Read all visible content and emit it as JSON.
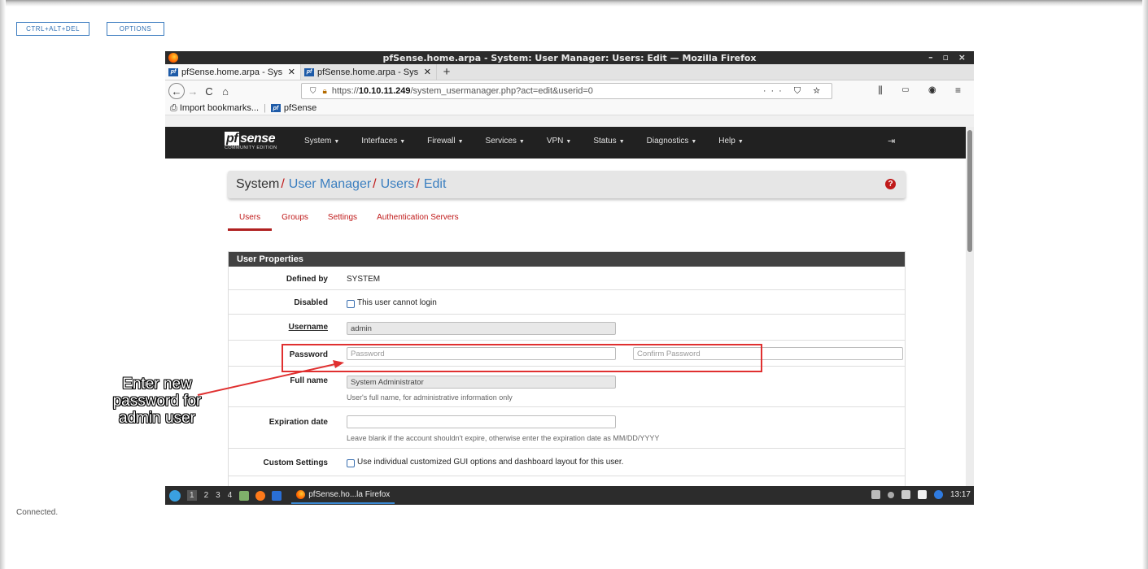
{
  "outer": {
    "ctrl_alt_del": "CTRL+ALT+DEL",
    "options": "OPTIONS",
    "status": "Connected."
  },
  "window": {
    "title": "pfSense.home.arpa - System: User Manager: Users: Edit — Mozilla Firefox",
    "controls": "– ▫ ×"
  },
  "tabs": [
    {
      "title": "pfSense.home.arpa - Sys",
      "fav": "pf"
    },
    {
      "title": "pfSense.home.arpa - Sys",
      "fav": "pf"
    }
  ],
  "url": {
    "prefix": "https://",
    "host": "10.10.11.249",
    "path": "/system_usermanager.php?act=edit&userid=0",
    "actions": "··· ⛉ ☆"
  },
  "nav_icons": {
    "back": "←",
    "forward": "→",
    "reload": "C",
    "home": "⌂",
    "right": "⫼ ▭ ◉ ≡"
  },
  "bookmarks": {
    "import": "Import bookmarks...",
    "pfsense": "pfSense"
  },
  "pfsense": {
    "logo": "sense",
    "logo_pf": "pf",
    "edition": "COMMUNITY EDITION",
    "menu": [
      "System",
      "Interfaces",
      "Firewall",
      "Services",
      "VPN",
      "Status",
      "Diagnostics",
      "Help"
    ],
    "logout_icon": "⇥"
  },
  "breadcrumb": {
    "root": "System",
    "l1": "User Manager",
    "l2": "Users",
    "l3": "Edit",
    "help": "?"
  },
  "subtabs": [
    "Users",
    "Groups",
    "Settings",
    "Authentication Servers"
  ],
  "panel": {
    "title": "User Properties",
    "defined_by_label": "Defined by",
    "defined_by_value": "SYSTEM",
    "disabled_label": "Disabled",
    "disabled_text": "This user cannot login",
    "username_label": "Username",
    "username_value": "admin",
    "password_label": "Password",
    "password_placeholder": "Password",
    "confirm_placeholder": "Confirm Password",
    "fullname_label": "Full name",
    "fullname_value": "System Administrator",
    "fullname_help": "User's full name, for administrative information only",
    "expiration_label": "Expiration date",
    "expiration_help": "Leave blank if the account shouldn't expire, otherwise enter the expiration date as MM/DD/YYYY",
    "custom_label": "Custom Settings",
    "custom_text": "Use individual customized GUI options and dashboard layout for this user."
  },
  "taskbar": {
    "workspaces": [
      "1",
      "2",
      "3",
      "4"
    ],
    "task_label": "pfSense.ho...la Firefox",
    "clock": "13:17"
  },
  "annotation": {
    "line1": "Enter new",
    "line2": "password for",
    "line3": "admin user"
  },
  "colors": {
    "accent_red": "#e03030",
    "pfsense_nav": "#212121",
    "link_blue": "#3b7fc0",
    "tab_red": "#c01a1a"
  }
}
